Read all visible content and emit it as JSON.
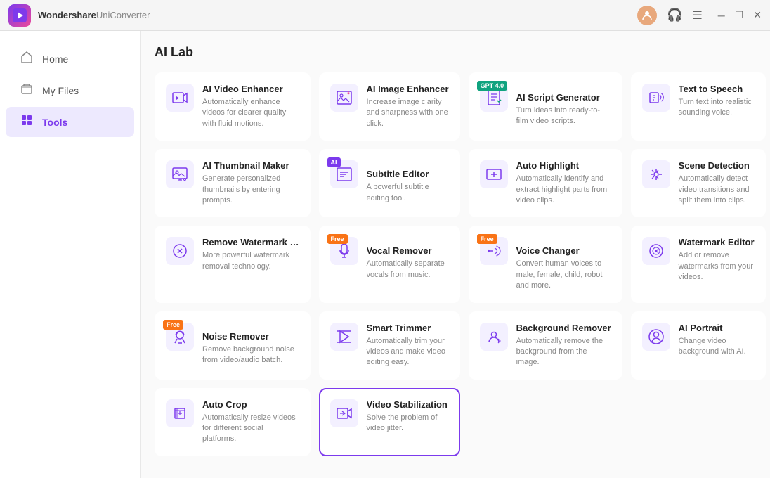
{
  "app": {
    "name": "Wondershare",
    "sub_name": "UniConverter",
    "logo_text": "▶"
  },
  "titlebar": {
    "avatar_text": "👤",
    "headset_text": "🎧",
    "menu_text": "☰",
    "minimize_text": "─",
    "maximize_text": "☐",
    "close_text": "✕"
  },
  "sidebar": {
    "items": [
      {
        "id": "home",
        "label": "Home",
        "icon": "⌂",
        "active": false
      },
      {
        "id": "my-files",
        "label": "My Files",
        "icon": "📁",
        "active": false
      },
      {
        "id": "tools",
        "label": "Tools",
        "icon": "🔧",
        "active": true
      }
    ]
  },
  "page": {
    "title": "AI Lab"
  },
  "tools": [
    {
      "id": "ai-video-enhancer",
      "name": "AI Video Enhancer",
      "desc": "Automatically enhance videos for clearer quality with fluid motions.",
      "icon": "▶",
      "badge": null,
      "selected": false
    },
    {
      "id": "ai-image-enhancer",
      "name": "AI Image Enhancer",
      "desc": "Increase image clarity and sharpness with one click.",
      "icon": "🖼",
      "badge": null,
      "selected": false
    },
    {
      "id": "ai-script-generator",
      "name": "AI Script Generator",
      "desc": "Turn ideas into ready-to-film video scripts.",
      "icon": "▶",
      "badge": "gpt",
      "badge_text": "GPT 4.0",
      "selected": false
    },
    {
      "id": "text-to-speech",
      "name": "Text to Speech",
      "desc": "Turn text into realistic sounding voice.",
      "icon": "🔊",
      "badge": null,
      "selected": false
    },
    {
      "id": "ai-thumbnail-maker",
      "name": "AI Thumbnail Maker",
      "desc": "Generate personalized thumbnails by entering prompts.",
      "icon": "🖼",
      "badge": null,
      "selected": false
    },
    {
      "id": "subtitle-editor",
      "name": "Subtitle Editor",
      "desc": "A powerful subtitle editing tool.",
      "icon": "T",
      "badge": "ai",
      "badge_text": "AI",
      "selected": false
    },
    {
      "id": "auto-highlight",
      "name": "Auto Highlight",
      "desc": "Automatically identify and extract highlight parts from video clips.",
      "icon": "✦",
      "badge": null,
      "selected": false
    },
    {
      "id": "scene-detection",
      "name": "Scene Detection",
      "desc": "Automatically detect video transitions and split them into clips.",
      "icon": "↔",
      "badge": null,
      "selected": false
    },
    {
      "id": "remove-watermark",
      "name": "Remove Watermark …",
      "desc": "More powerful watermark removal technology.",
      "icon": "⊙",
      "badge": null,
      "selected": false
    },
    {
      "id": "vocal-remover",
      "name": "Vocal Remover",
      "desc": "Automatically separate vocals from music.",
      "icon": "♪",
      "badge": "free",
      "badge_text": "Free",
      "selected": false
    },
    {
      "id": "voice-changer",
      "name": "Voice Changer",
      "desc": "Convert human voices to male, female, child, robot and more.",
      "icon": "🔈",
      "badge": "free",
      "badge_text": "Free",
      "selected": false
    },
    {
      "id": "watermark-editor",
      "name": "Watermark Editor",
      "desc": "Add or remove watermarks from your videos.",
      "icon": "⊙",
      "badge": null,
      "selected": false
    },
    {
      "id": "noise-remover",
      "name": "Noise Remover",
      "desc": "Remove background noise from video/audio batch.",
      "icon": "🎧",
      "badge": "free",
      "badge_text": "Free",
      "selected": false
    },
    {
      "id": "smart-trimmer",
      "name": "Smart Trimmer",
      "desc": "Automatically trim your videos and make video editing easy.",
      "icon": "✂",
      "badge": null,
      "selected": false
    },
    {
      "id": "background-remover",
      "name": "Background Remover",
      "desc": "Automatically remove the background from the image.",
      "icon": "👤",
      "badge": null,
      "selected": false
    },
    {
      "id": "ai-portrait",
      "name": "AI Portrait",
      "desc": "Change video background with AI.",
      "icon": "⊙",
      "badge": null,
      "selected": false
    },
    {
      "id": "auto-crop",
      "name": "Auto Crop",
      "desc": "Automatically resize videos for different social platforms.",
      "icon": "▶",
      "badge": null,
      "selected": false
    },
    {
      "id": "video-stabilization",
      "name": "Video Stabilization",
      "desc": "Solve the problem of video jitter.",
      "icon": "🎬",
      "badge": null,
      "selected": true
    }
  ]
}
